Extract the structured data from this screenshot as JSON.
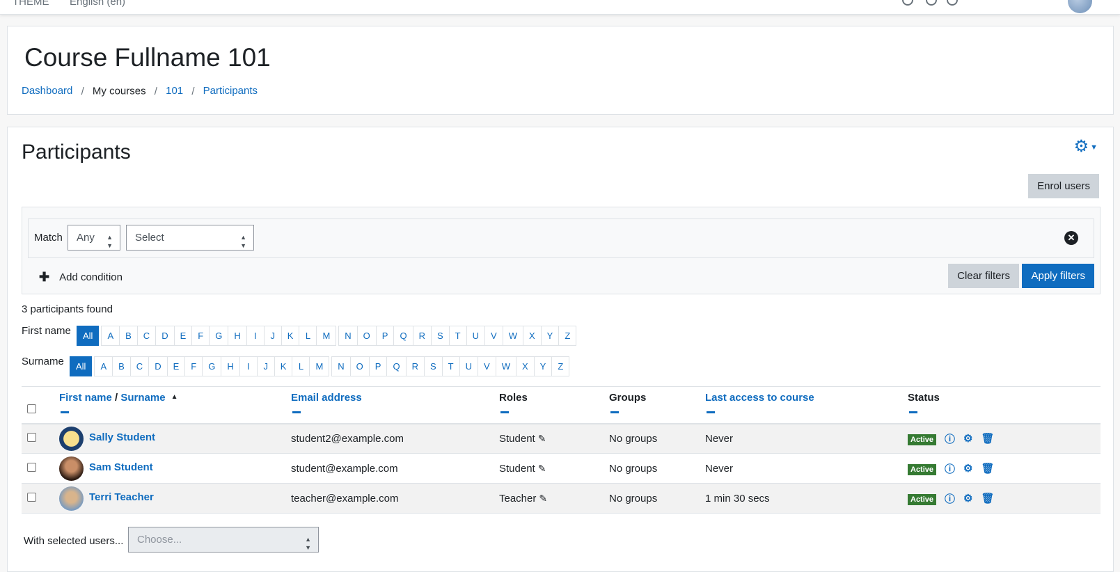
{
  "topnav": {
    "theme_label": "THEME",
    "language_label": "English (en)"
  },
  "header": {
    "course_title": "Course Fullname 101",
    "breadcrumb": [
      "Dashboard",
      "My courses",
      "101",
      "Participants"
    ]
  },
  "main": {
    "heading": "Participants",
    "enrol_button": "Enrol users"
  },
  "filters": {
    "match_label": "Match",
    "match_value": "Any",
    "type_select_value": "Select",
    "add_condition": "Add condition",
    "clear_button": "Clear filters",
    "apply_button": "Apply filters"
  },
  "participants_found": "3 participants found",
  "initials": {
    "first_label": "First name",
    "surname_label": "Surname",
    "all": "All",
    "letters": [
      "A",
      "B",
      "C",
      "D",
      "E",
      "F",
      "G",
      "H",
      "I",
      "J",
      "K",
      "L",
      "M",
      "N",
      "O",
      "P",
      "Q",
      "R",
      "S",
      "T",
      "U",
      "V",
      "W",
      "X",
      "Y",
      "Z"
    ]
  },
  "table": {
    "headers": {
      "firstname": "First name",
      "slash": "/",
      "surname": "Surname",
      "email": "Email address",
      "roles": "Roles",
      "groups": "Groups",
      "lastaccess": "Last access to course",
      "status": "Status"
    },
    "rows": [
      {
        "name": "Sally Student",
        "email": "student2@example.com",
        "role": "Student",
        "groups": "No groups",
        "lastaccess": "Never",
        "status": "Active"
      },
      {
        "name": "Sam Student",
        "email": "student@example.com",
        "role": "Student",
        "groups": "No groups",
        "lastaccess": "Never",
        "status": "Active"
      },
      {
        "name": "Terri Teacher",
        "email": "teacher@example.com",
        "role": "Teacher",
        "groups": "No groups",
        "lastaccess": "1 min 30 secs",
        "status": "Active"
      }
    ]
  },
  "bulk": {
    "label": "With selected users...",
    "placeholder": "Choose..."
  },
  "icons": {
    "gear": "gear-icon",
    "info": "info-icon",
    "cog": "cog-icon",
    "trash": "trash-icon",
    "pencil": "pencil-icon",
    "remove": "close-circle-icon",
    "plus": "plus-icon"
  },
  "colors": {
    "link": "#0f6cbf",
    "active_badge": "#357a32",
    "secondary_button": "#ced4da"
  }
}
